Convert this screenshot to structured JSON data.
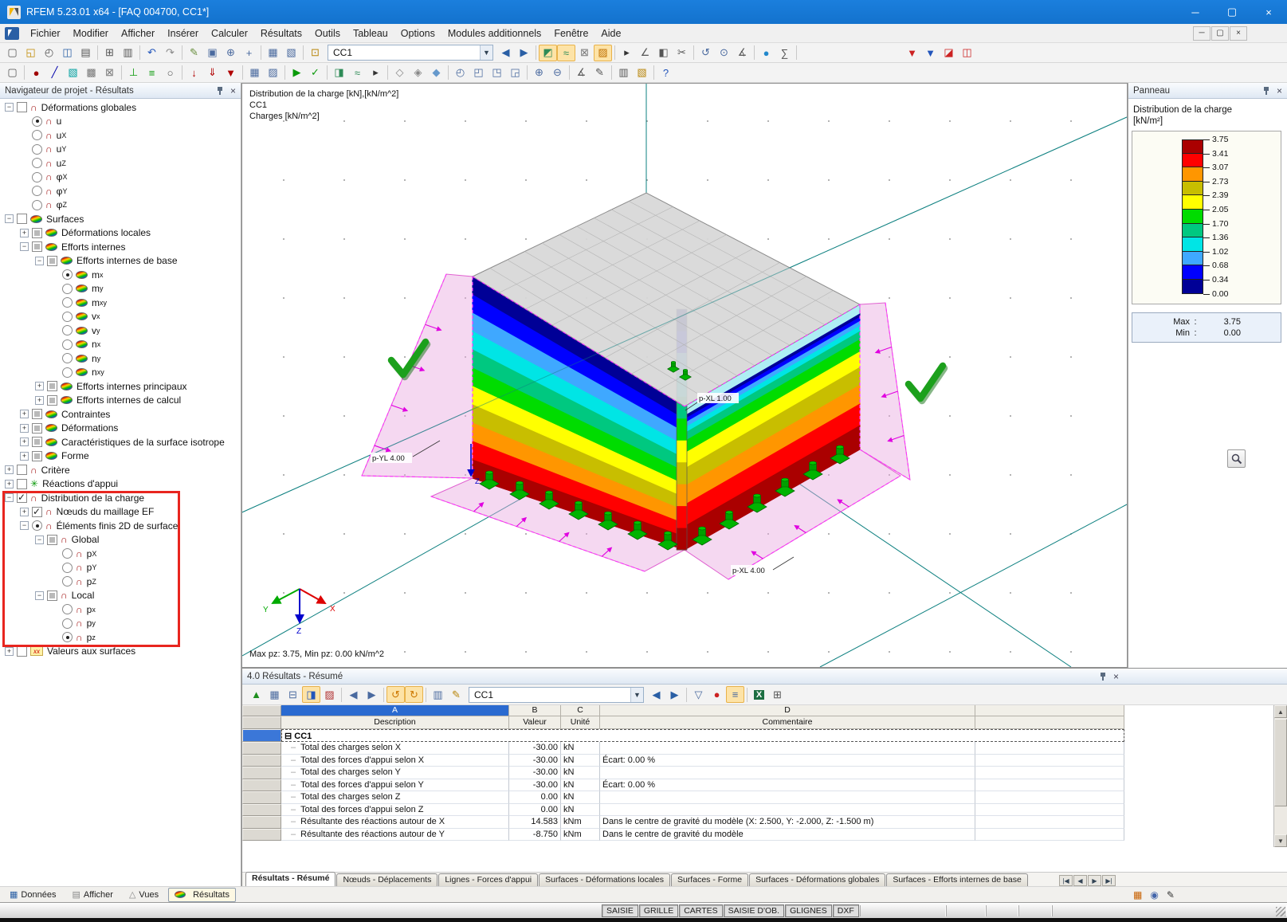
{
  "window": {
    "title": "RFEM 5.23.01 x64 - [FAQ 004700, CC1*]"
  },
  "menu": {
    "items": [
      "Fichier",
      "Modifier",
      "Afficher",
      "Insérer",
      "Calculer",
      "Résultats",
      "Outils",
      "Tableau",
      "Options",
      "Modules additionnels",
      "Fenêtre",
      "Aide"
    ]
  },
  "toolbar_main": {
    "combo_value": "CC1",
    "icons_a": [
      {
        "n": "new-file-icon",
        "g": "▢",
        "c": "#555"
      },
      {
        "n": "open-folder-icon",
        "g": "◱",
        "c": "#c08a00"
      },
      {
        "n": "network-project-icon",
        "g": "◴",
        "c": "#555"
      },
      {
        "n": "save-icon",
        "g": "◫",
        "c": "#2a5fa5"
      },
      {
        "n": "print-icon",
        "g": "▤",
        "c": "#555"
      },
      {
        "sep": true
      },
      {
        "n": "copy-icon",
        "g": "⊞",
        "c": "#555"
      },
      {
        "n": "gallery-icon",
        "g": "▥",
        "c": "#555"
      },
      {
        "sep": true
      },
      {
        "n": "undo-icon",
        "g": "↶",
        "c": "#2255bb"
      },
      {
        "n": "redo-icon",
        "g": "↷",
        "c": "#888"
      },
      {
        "sep": true
      },
      {
        "n": "edit-pen-icon",
        "g": "✎",
        "c": "#6a8f3f"
      },
      {
        "n": "zoom-window-icon",
        "g": "▣",
        "c": "#4a6a9f"
      },
      {
        "n": "zoom-in-icon",
        "g": "⊕",
        "c": "#4a6a9f"
      },
      {
        "n": "pan-icon",
        "g": "+",
        "c": "#4a6a9f"
      },
      {
        "sep": true
      },
      {
        "n": "table-icon",
        "g": "▦",
        "c": "#4a6a9f"
      },
      {
        "n": "table-manager-icon",
        "g": "▧",
        "c": "#4a6a9f"
      },
      {
        "sep": true
      },
      {
        "n": "numbering-icon",
        "g": "⊡",
        "c": "#b8860b"
      }
    ],
    "icons_b": [
      {
        "n": "previous-loadcase-icon",
        "g": "◀",
        "c": "#2a5fa5"
      },
      {
        "n": "next-loadcase-icon",
        "g": "▶",
        "c": "#2a5fa5"
      },
      {
        "sep": true
      },
      {
        "n": "show-results-icon",
        "g": "◩",
        "c": "#2e8b57",
        "hl": true
      },
      {
        "n": "isolines-icon",
        "g": "≈",
        "c": "#2e8b57",
        "hl": true
      },
      {
        "n": "result-values-icon",
        "g": "⊠",
        "c": "#777"
      },
      {
        "n": "render-icon",
        "g": "▨",
        "c": "#c07000",
        "hl": true
      },
      {
        "sep": true
      },
      {
        "n": "animation-icon",
        "g": "▸",
        "c": "#333"
      },
      {
        "n": "section-icon",
        "g": "∠",
        "c": "#555"
      },
      {
        "n": "visibility-icon",
        "g": "◧",
        "c": "#555"
      },
      {
        "n": "clip-icon",
        "g": "✂",
        "c": "#555"
      },
      {
        "sep": true
      },
      {
        "n": "rotate-view-icon",
        "g": "↺",
        "c": "#4a6a9f"
      },
      {
        "n": "zoom-all-icon",
        "g": "⊙",
        "c": "#4a6a9f"
      },
      {
        "n": "measure-icon",
        "g": "∡",
        "c": "#555"
      },
      {
        "sep": true
      },
      {
        "n": "info-icon",
        "g": "●",
        "c": "#2288cc"
      },
      {
        "n": "calculator-icon",
        "g": "∑",
        "c": "#555"
      },
      {
        "sep": true
      },
      {
        "gap": 130
      },
      {
        "n": "printout-report-icon",
        "g": "▼",
        "c": "#cc2222"
      },
      {
        "n": "printout-graphic-icon",
        "g": "▼",
        "c": "#2255bb"
      },
      {
        "n": "export-pdf-icon",
        "g": "◪",
        "c": "#cc2222"
      },
      {
        "n": "export-pdf-3d-icon",
        "g": "◫",
        "c": "#cc2222"
      }
    ]
  },
  "toolbar_row2": {
    "icons": [
      {
        "n": "select-icon",
        "g": "▢",
        "c": "#555"
      },
      {
        "sep": true
      },
      {
        "n": "node-icon",
        "g": "●",
        "c": "#a00000"
      },
      {
        "n": "line-icon",
        "g": "╱",
        "c": "#0000aa"
      },
      {
        "n": "surface-icon",
        "g": "▧",
        "c": "#00a0a0"
      },
      {
        "n": "solid-icon",
        "g": "▩",
        "c": "#777"
      },
      {
        "n": "opening-icon",
        "g": "⊠",
        "c": "#777"
      },
      {
        "sep": true
      },
      {
        "n": "nodal-support-icon",
        "g": "⊥",
        "c": "#0a9a0a"
      },
      {
        "n": "line-support-icon",
        "g": "≡",
        "c": "#0a9a0a"
      },
      {
        "n": "hinge-icon",
        "g": "○",
        "c": "#555"
      },
      {
        "sep": true
      },
      {
        "n": "nodal-load-icon",
        "g": "↓",
        "c": "#b00000"
      },
      {
        "n": "line-load-icon",
        "g": "⇓",
        "c": "#b00000"
      },
      {
        "n": "surface-load-icon",
        "g": "▼",
        "c": "#b00000"
      },
      {
        "sep": true
      },
      {
        "n": "mesh-icon",
        "g": "▦",
        "c": "#4a6a9f"
      },
      {
        "n": "mesh-settings-icon",
        "g": "▨",
        "c": "#4a6a9f"
      },
      {
        "sep": true
      },
      {
        "n": "calculate-icon",
        "g": "▶",
        "c": "#0a9a0a"
      },
      {
        "n": "check-model-icon",
        "g": "✓",
        "c": "#0a9a0a"
      },
      {
        "sep": true
      },
      {
        "n": "results-nav-icon",
        "g": "◨",
        "c": "#2e8b57"
      },
      {
        "n": "deformation-icon",
        "g": "≈",
        "c": "#2e8b57"
      },
      {
        "n": "animate-icon",
        "g": "▸",
        "c": "#333"
      },
      {
        "sep": true
      },
      {
        "n": "grid-snap-icon",
        "g": "◇",
        "c": "#888"
      },
      {
        "n": "guidelines-icon",
        "g": "◈",
        "c": "#888"
      },
      {
        "n": "work-plane-icon",
        "g": "◆",
        "c": "#6699cc"
      },
      {
        "sep": true
      },
      {
        "n": "view-isometric-icon",
        "g": "◴",
        "c": "#4a6a9f"
      },
      {
        "n": "view-x-icon",
        "g": "◰",
        "c": "#4a6a9f"
      },
      {
        "n": "view-y-icon",
        "g": "◳",
        "c": "#4a6a9f"
      },
      {
        "n": "view-z-icon",
        "g": "◲",
        "c": "#4a6a9f"
      },
      {
        "sep": true
      },
      {
        "n": "zoom-in-2-icon",
        "g": "⊕",
        "c": "#4a6a9f"
      },
      {
        "n": "zoom-out-icon",
        "g": "⊖",
        "c": "#4a6a9f"
      },
      {
        "sep": true
      },
      {
        "n": "dimension-icon",
        "g": "∡",
        "c": "#555"
      },
      {
        "n": "comment-icon",
        "g": "✎",
        "c": "#555"
      },
      {
        "sep": true
      },
      {
        "n": "display-properties-icon",
        "g": "▥",
        "c": "#555"
      },
      {
        "n": "colors-icon",
        "g": "▧",
        "c": "#b8860b"
      },
      {
        "sep": true
      },
      {
        "n": "help-icon",
        "g": "?",
        "c": "#2255bb"
      }
    ]
  },
  "navigator": {
    "title": "Navigateur de projet - Résultats",
    "tree": [
      {
        "d": 0,
        "e": "-",
        "c": "cb",
        "i": "d",
        "t": "Déformations globales",
        "s": ""
      },
      {
        "d": 1,
        "e": "",
        "c": "rs",
        "i": "d",
        "t": "u",
        "s": ""
      },
      {
        "d": 1,
        "e": "",
        "c": "r",
        "i": "d",
        "t": "u",
        "s": "X"
      },
      {
        "d": 1,
        "e": "",
        "c": "r",
        "i": "d",
        "t": "u",
        "s": "Y"
      },
      {
        "d": 1,
        "e": "",
        "c": "r",
        "i": "d",
        "t": "u",
        "s": "Z"
      },
      {
        "d": 1,
        "e": "",
        "c": "r",
        "i": "d",
        "t": "φ",
        "s": "X"
      },
      {
        "d": 1,
        "e": "",
        "c": "r",
        "i": "d",
        "t": "φ",
        "s": "Y"
      },
      {
        "d": 1,
        "e": "",
        "c": "r",
        "i": "d",
        "t": "φ",
        "s": "Z"
      },
      {
        "d": 0,
        "e": "-",
        "c": "cb",
        "i": "s",
        "t": "Surfaces",
        "s": ""
      },
      {
        "d": 1,
        "e": "+",
        "c": "cbg",
        "i": "s",
        "t": "Déformations locales",
        "s": ""
      },
      {
        "d": 1,
        "e": "-",
        "c": "cbg",
        "i": "s",
        "t": "Efforts internes",
        "s": ""
      },
      {
        "d": 2,
        "e": "-",
        "c": "cbg",
        "i": "s",
        "t": "Efforts internes de base",
        "s": ""
      },
      {
        "d": 3,
        "e": "",
        "c": "rs",
        "i": "s",
        "t": "m",
        "s": "x"
      },
      {
        "d": 3,
        "e": "",
        "c": "r",
        "i": "s",
        "t": "m",
        "s": "y"
      },
      {
        "d": 3,
        "e": "",
        "c": "r",
        "i": "s",
        "t": "m",
        "s": "xy"
      },
      {
        "d": 3,
        "e": "",
        "c": "r",
        "i": "s",
        "t": "v",
        "s": "x"
      },
      {
        "d": 3,
        "e": "",
        "c": "r",
        "i": "s",
        "t": "v",
        "s": "y"
      },
      {
        "d": 3,
        "e": "",
        "c": "r",
        "i": "s",
        "t": "n",
        "s": "x"
      },
      {
        "d": 3,
        "e": "",
        "c": "r",
        "i": "s",
        "t": "n",
        "s": "y"
      },
      {
        "d": 3,
        "e": "",
        "c": "r",
        "i": "s",
        "t": "n",
        "s": "xy"
      },
      {
        "d": 2,
        "e": "+",
        "c": "cbg",
        "i": "s",
        "t": "Efforts internes principaux",
        "s": ""
      },
      {
        "d": 2,
        "e": "+",
        "c": "cbg",
        "i": "s",
        "t": "Efforts internes de calcul",
        "s": ""
      },
      {
        "d": 1,
        "e": "+",
        "c": "cbg",
        "i": "s",
        "t": "Contraintes",
        "s": ""
      },
      {
        "d": 1,
        "e": "+",
        "c": "cbg",
        "i": "s",
        "t": "Déformations",
        "s": ""
      },
      {
        "d": 1,
        "e": "+",
        "c": "cbg",
        "i": "s",
        "t": "Caractéristiques de la surface isotrope",
        "s": ""
      },
      {
        "d": 1,
        "e": "+",
        "c": "cbg",
        "i": "s",
        "t": "Forme",
        "s": ""
      },
      {
        "d": 0,
        "e": "+",
        "c": "cb",
        "i": "d",
        "t": "Critère",
        "s": ""
      },
      {
        "d": 0,
        "e": "+",
        "c": "cb",
        "i": "a",
        "t": "Réactions d'appui",
        "s": ""
      },
      {
        "d": 0,
        "e": "-",
        "c": "cbc",
        "i": "d",
        "t": "Distribution de la charge",
        "s": ""
      },
      {
        "d": 1,
        "e": "+",
        "c": "cbc",
        "i": "d",
        "t": "Nœuds du maillage EF",
        "s": ""
      },
      {
        "d": 1,
        "e": "-",
        "c": "rs",
        "i": "d",
        "t": "Éléments finis 2D de surface",
        "s": ""
      },
      {
        "d": 2,
        "e": "-",
        "c": "cbg",
        "i": "d",
        "t": "Global",
        "s": ""
      },
      {
        "d": 3,
        "e": "",
        "c": "r",
        "i": "d",
        "t": "p",
        "s": "X"
      },
      {
        "d": 3,
        "e": "",
        "c": "r",
        "i": "d",
        "t": "p",
        "s": "Y"
      },
      {
        "d": 3,
        "e": "",
        "c": "r",
        "i": "d",
        "t": "p",
        "s": "Z"
      },
      {
        "d": 2,
        "e": "-",
        "c": "cbg",
        "i": "d",
        "t": "Local",
        "s": ""
      },
      {
        "d": 3,
        "e": "",
        "c": "r",
        "i": "d",
        "t": "p",
        "s": "x"
      },
      {
        "d": 3,
        "e": "",
        "c": "r",
        "i": "d",
        "t": "p",
        "s": "y"
      },
      {
        "d": 3,
        "e": "",
        "c": "rs",
        "i": "d",
        "t": "p",
        "s": "z"
      },
      {
        "d": 0,
        "e": "+",
        "c": "cb",
        "i": "x",
        "t": "Valeurs aux surfaces",
        "s": ""
      }
    ]
  },
  "viewport": {
    "annotations": [
      "Distribution de la charge [kN],[kN/m^2]",
      "CC1",
      "Charges [kN/m^2]"
    ],
    "status": "Max pz: 3.75, Min pz: 0.00 kN/m^2",
    "labels": {
      "left": "p-YL 4.00",
      "corner": "p-XL 1.00",
      "right": "p-XL 4.00"
    },
    "axes": {
      "x": "X",
      "y": "Y",
      "z": "Z"
    }
  },
  "panel": {
    "title": "Panneau",
    "subtitle": "Distribution de la charge",
    "unit": "[kN/m²]",
    "legend": {
      "colors": [
        "#aa0000",
        "#ff0000",
        "#ff9600",
        "#c8be00",
        "#ffff00",
        "#00dc00",
        "#00c880",
        "#00e5e5",
        "#3fa8ff",
        "#0000ff",
        "#000096"
      ],
      "values": [
        "3.75",
        "3.41",
        "3.07",
        "2.73",
        "2.39",
        "2.05",
        "1.70",
        "1.36",
        "1.02",
        "0.68",
        "0.34",
        "0.00"
      ]
    },
    "max_label": "Max",
    "max_value": "3.75",
    "min_label": "Min",
    "min_value": "0.00"
  },
  "results": {
    "title": "4.0 Résultats - Résumé",
    "combo_value": "CC1",
    "toolbar_icons": [
      {
        "n": "export-chart-icon",
        "g": "▲",
        "c": "#1f8f1f"
      },
      {
        "n": "table-settings-icon",
        "g": "▦",
        "c": "#4a6a9f"
      },
      {
        "n": "table-rows-icon",
        "g": "⊟",
        "c": "#4a6a9f"
      },
      {
        "n": "table-filter-blue-icon",
        "g": "◨",
        "c": "#2255bb",
        "hl": true
      },
      {
        "n": "table-stats-icon",
        "g": "▨",
        "c": "#b03030"
      },
      {
        "sep": true
      },
      {
        "n": "column-prev-icon",
        "g": "◀",
        "c": "#4a6a9f"
      },
      {
        "n": "column-next-icon",
        "g": "▶",
        "c": "#4a6a9f"
      },
      {
        "sep": true
      },
      {
        "n": "table-undo-icon",
        "g": "↺",
        "c": "#cc7700",
        "hl": true
      },
      {
        "n": "table-redo-icon",
        "g": "↻",
        "c": "#cc7700",
        "hl": true
      },
      {
        "sep": true
      },
      {
        "n": "table-view-icon",
        "g": "▥",
        "c": "#4a6a9f"
      },
      {
        "n": "table-edit-icon",
        "g": "✎",
        "c": "#b8860b"
      }
    ],
    "toolbar_icons_b": [
      {
        "n": "result-prev-icon",
        "g": "◀",
        "c": "#2a5fa5"
      },
      {
        "n": "result-next-icon",
        "g": "▶",
        "c": "#2a5fa5"
      },
      {
        "sep": true
      },
      {
        "n": "filter-icon",
        "g": "▽",
        "c": "#4a6a9f"
      },
      {
        "n": "goto-icon",
        "g": "●",
        "c": "#cc2222"
      },
      {
        "n": "sort-icon",
        "g": "≡",
        "c": "#4a6a9f",
        "hl": true
      },
      {
        "sep": true
      },
      {
        "n": "excel-export-icon",
        "g": "X",
        "c": "#ffffff",
        "bg": "#1d6f42"
      },
      {
        "n": "table-calculator-icon",
        "g": "⊞",
        "c": "#555"
      }
    ],
    "col_letters": [
      "A",
      "B",
      "C",
      "D"
    ],
    "col_headers": [
      "Description",
      "Valeur",
      "Unité",
      "Commentaire"
    ],
    "group_label": "CC1",
    "rows": [
      {
        "desc": "Total des charges selon X",
        "val": "-30.00",
        "unit": "kN",
        "comment": ""
      },
      {
        "desc": "Total des forces d'appui selon X",
        "val": "-30.00",
        "unit": "kN",
        "comment": "Écart:  0.00 %"
      },
      {
        "desc": "Total des charges selon Y",
        "val": "-30.00",
        "unit": "kN",
        "comment": ""
      },
      {
        "desc": "Total des forces d'appui selon Y",
        "val": "-30.00",
        "unit": "kN",
        "comment": "Écart:  0.00 %"
      },
      {
        "desc": "Total des charges selon Z",
        "val": "0.00",
        "unit": "kN",
        "comment": ""
      },
      {
        "desc": "Total des forces d'appui selon Z",
        "val": "0.00",
        "unit": "kN",
        "comment": ""
      },
      {
        "desc": "Résultante des réactions autour de X",
        "val": "14.583",
        "unit": "kNm",
        "comment": "Dans le centre de gravité du modèle (X: 2.500, Y: -2.000, Z: -1.500 m)"
      },
      {
        "desc": "Résultante des réactions autour de Y",
        "val": "-8.750",
        "unit": "kNm",
        "comment": "Dans le centre de gravité du modèle"
      }
    ],
    "tabs": [
      "Résultats - Résumé",
      "Nœuds - Déplacements",
      "Lignes - Forces d'appui",
      "Surfaces - Déformations locales",
      "Surfaces - Forme",
      "Surfaces - Déformations globales",
      "Surfaces - Efforts internes de base"
    ],
    "tab_nav": [
      "|◀",
      "◀",
      "▶",
      "▶|"
    ]
  },
  "panelbar": {
    "buttons": [
      {
        "label": "Données",
        "icon": "table"
      },
      {
        "label": "Afficher",
        "icon": "page"
      },
      {
        "label": "Vues",
        "icon": "view"
      },
      {
        "label": "Résultats",
        "icon": "surface",
        "active": true
      }
    ]
  },
  "statusbar": {
    "buttons": [
      "SAISIE",
      "GRILLE",
      "CARTES",
      "SAISIE D'OB.",
      "GLIGNES",
      "DXF"
    ]
  },
  "window_controls": {
    "minimize": "─",
    "maximize": "▢",
    "close": "×"
  }
}
